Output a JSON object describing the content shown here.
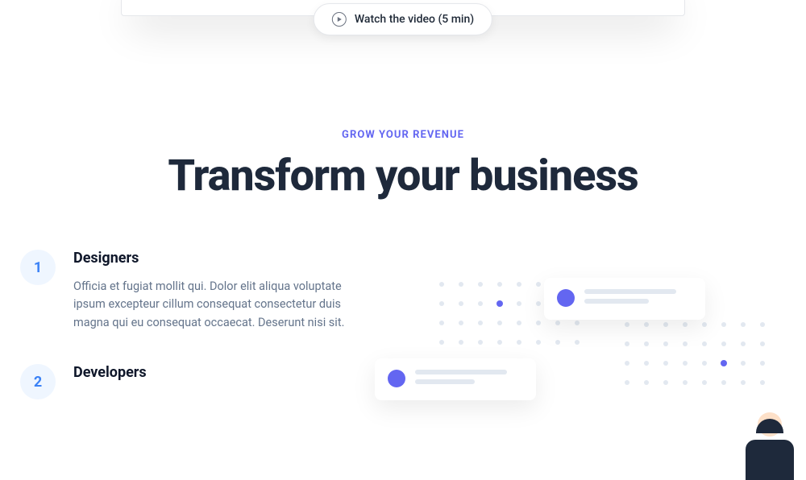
{
  "hero": {
    "watch_label": "Watch the video (5 min)"
  },
  "section": {
    "eyebrow": "GROW YOUR REVENUE",
    "heading": "Transform your business"
  },
  "features": [
    {
      "num": "1",
      "title": "Designers",
      "body": "Officia et fugiat mollit qui. Dolor elit aliqua voluptate ipsum excepteur cillum consequat consectetur duis magna qui eu consequat occaecat. Deserunt nisi sit."
    },
    {
      "num": "2",
      "title": "Developers",
      "body": ""
    }
  ]
}
